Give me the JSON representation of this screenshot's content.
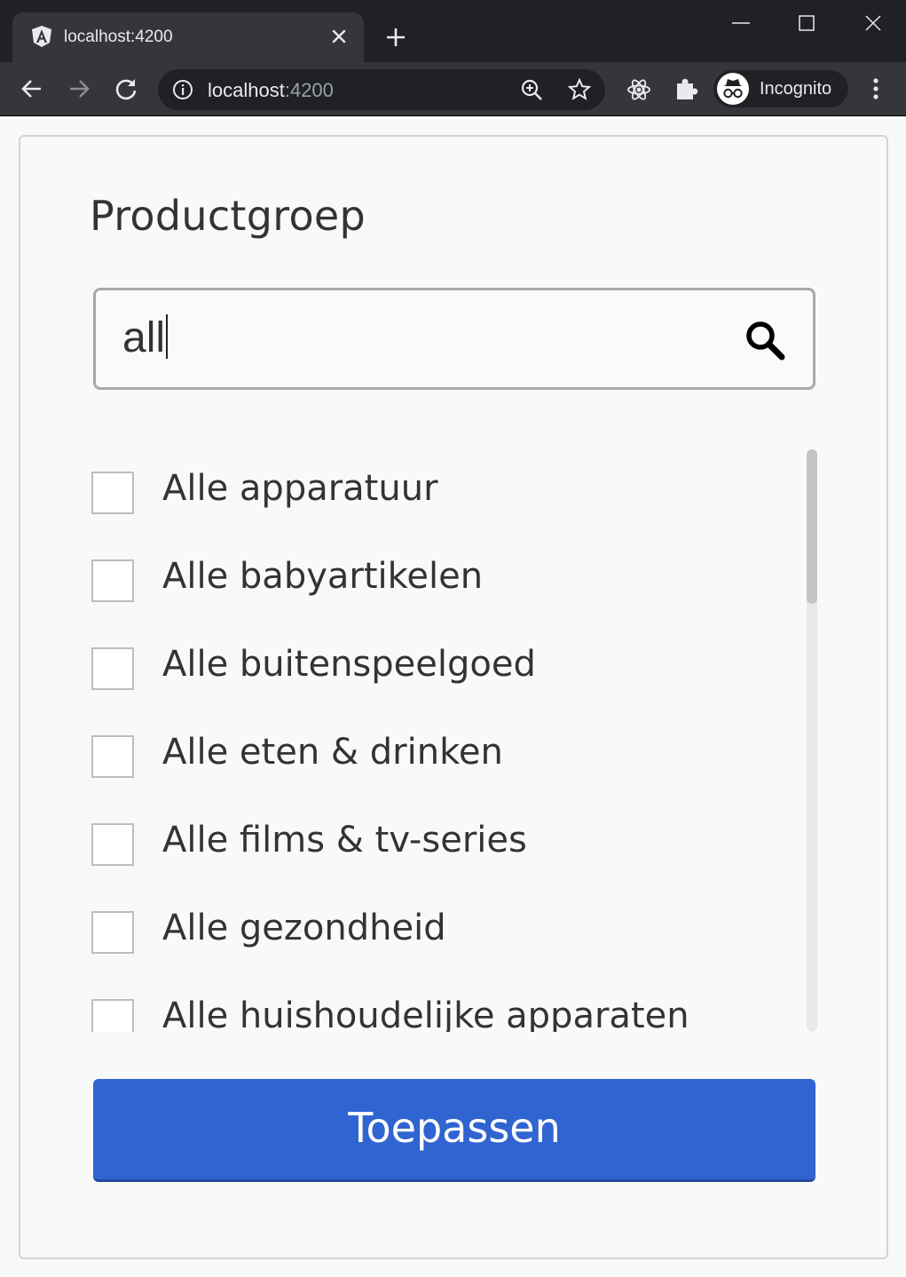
{
  "browser": {
    "tab_title": "localhost:4200",
    "url_host": "localhost",
    "url_port": ":4200",
    "profile_label": "Incognito"
  },
  "page": {
    "heading": "Productgroep",
    "search": {
      "value": "all"
    },
    "items": [
      {
        "label": "Alle apparatuur",
        "checked": false
      },
      {
        "label": "Alle babyartikelen",
        "checked": false
      },
      {
        "label": "Alle buitenspeelgoed",
        "checked": false
      },
      {
        "label": "Alle eten & drinken",
        "checked": false
      },
      {
        "label": "Alle films & tv-series",
        "checked": false
      },
      {
        "label": "Alle gezondheid",
        "checked": false
      },
      {
        "label": "Alle huishoudelijke apparaten",
        "checked": false
      }
    ],
    "apply_label": "Toepassen"
  },
  "colors": {
    "accent": "#2f64d1",
    "chrome_dark": "#202124",
    "chrome_tab": "#35363a"
  }
}
